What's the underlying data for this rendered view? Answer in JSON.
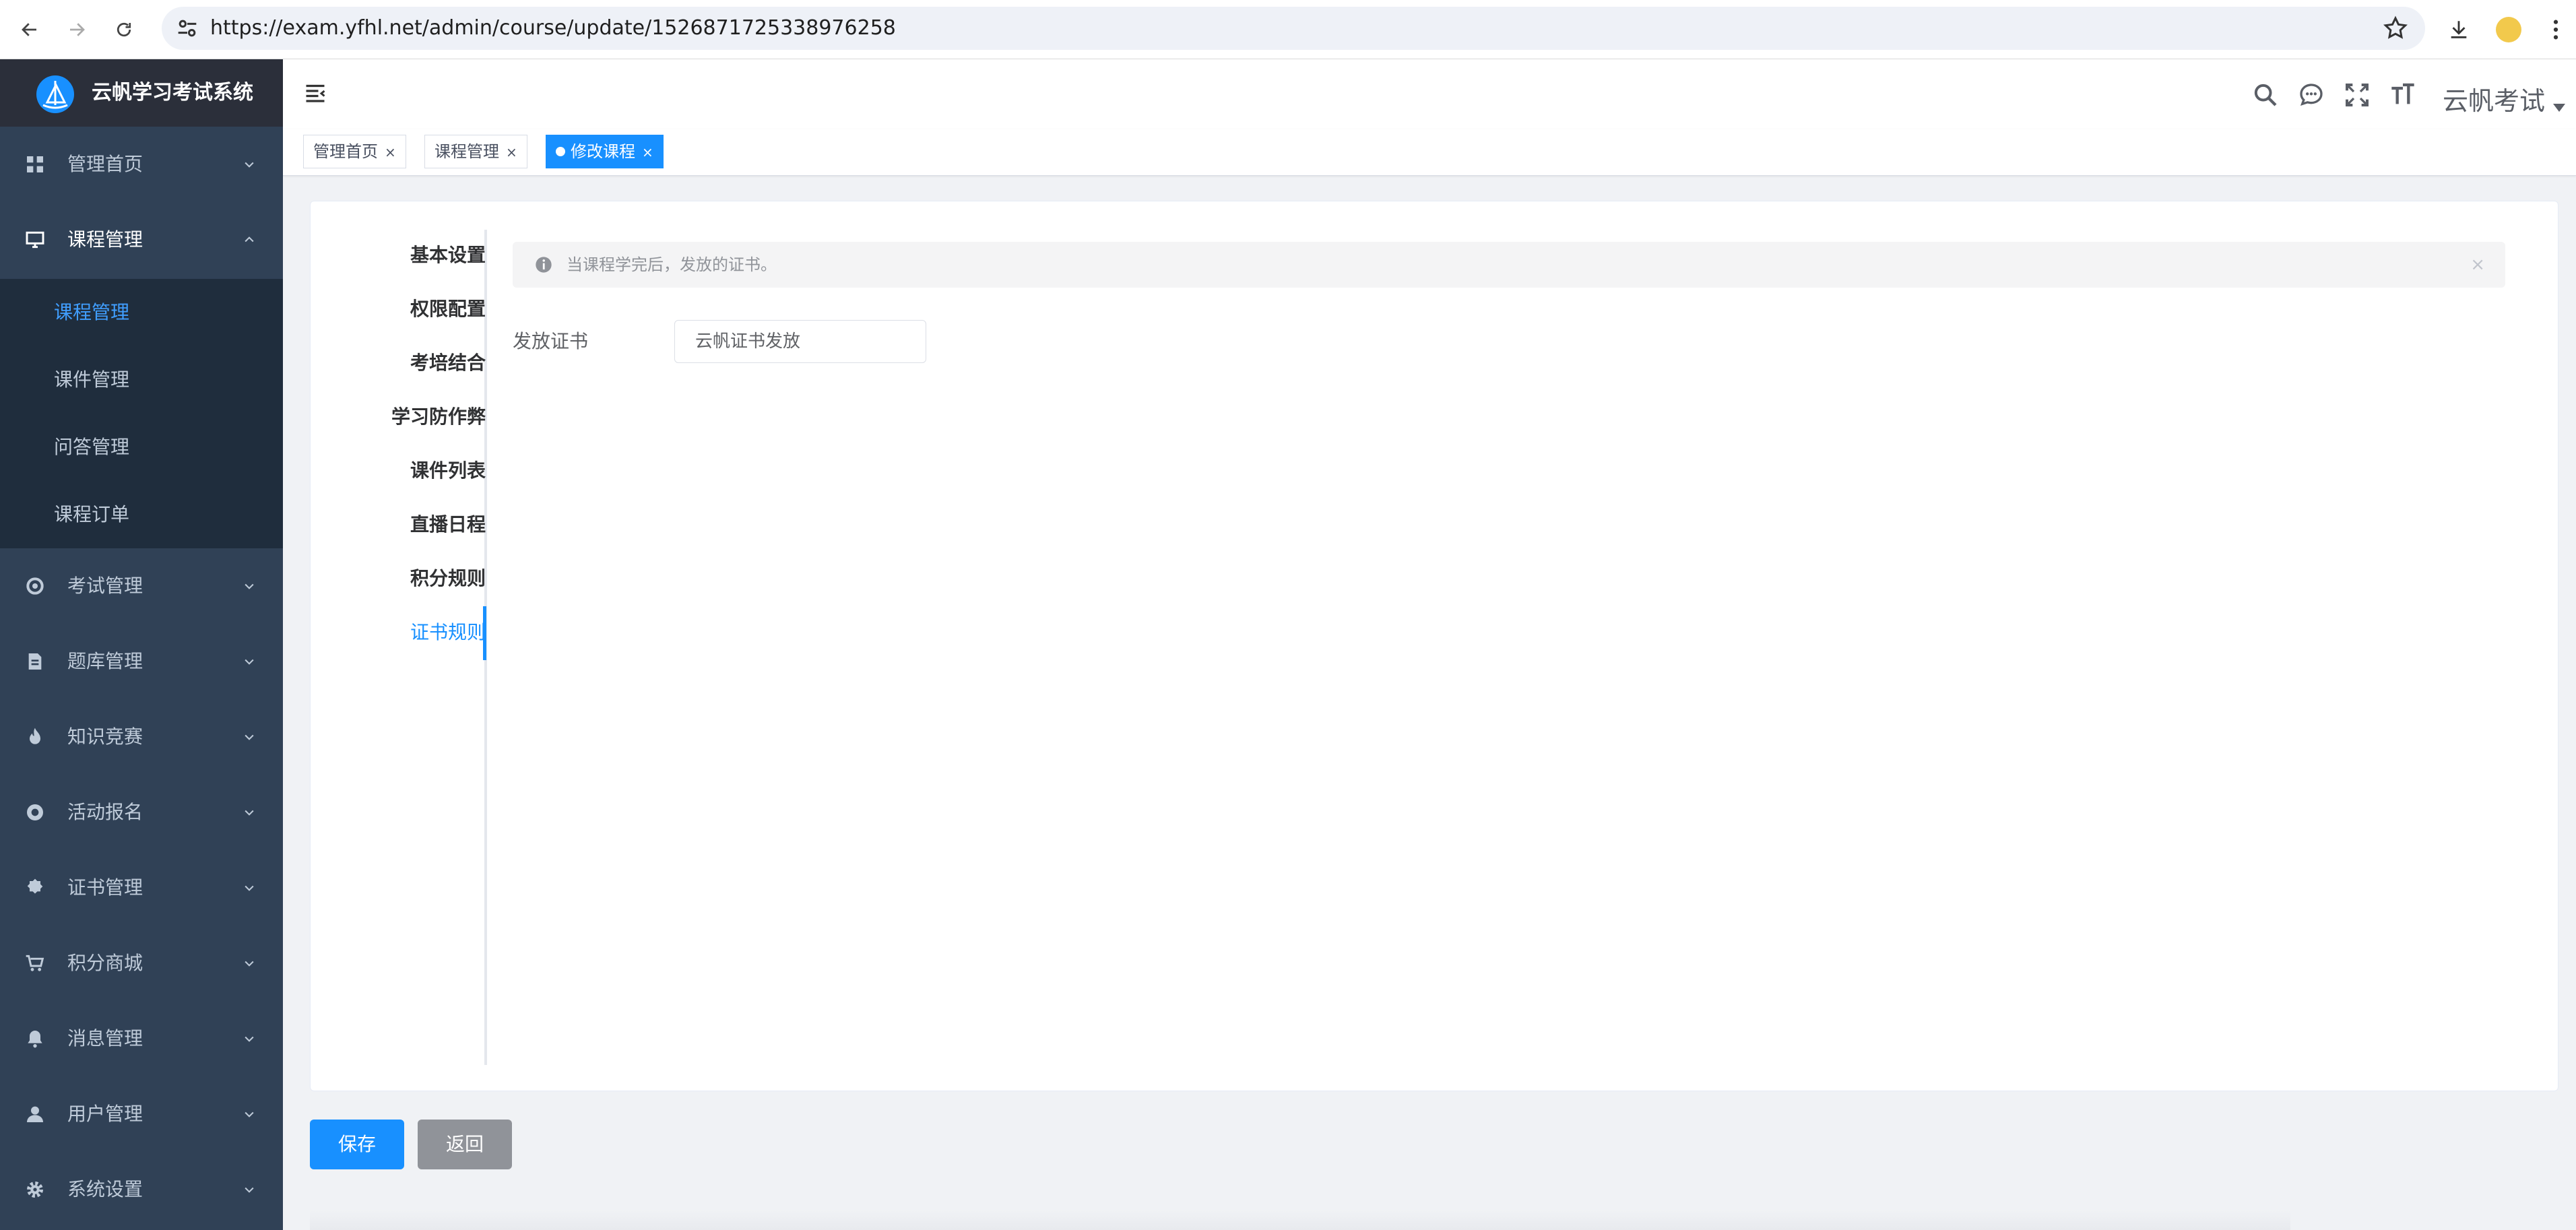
{
  "browser": {
    "url": "https://exam.yfhl.net/admin/course/update/1526871725338976258"
  },
  "app": {
    "title": "云帆学习考试系统"
  },
  "sidebar": {
    "items": [
      {
        "label": "管理首页",
        "icon": "dashboard-icon"
      },
      {
        "label": "课程管理",
        "icon": "monitor-icon",
        "expanded": true
      },
      {
        "label": "考试管理",
        "icon": "exam-icon"
      },
      {
        "label": "题库管理",
        "icon": "document-icon"
      },
      {
        "label": "知识竞赛",
        "icon": "fire-icon"
      },
      {
        "label": "活动报名",
        "icon": "target-icon"
      },
      {
        "label": "证书管理",
        "icon": "badge-icon"
      },
      {
        "label": "积分商城",
        "icon": "cart-icon"
      },
      {
        "label": "消息管理",
        "icon": "bell-icon"
      },
      {
        "label": "用户管理",
        "icon": "user-icon"
      },
      {
        "label": "系统设置",
        "icon": "gear-icon"
      }
    ],
    "subitems": [
      {
        "label": "课程管理",
        "active": true
      },
      {
        "label": "课件管理"
      },
      {
        "label": "问答管理"
      },
      {
        "label": "课程订单"
      }
    ]
  },
  "navbar": {
    "user": "云帆考试"
  },
  "tags": [
    {
      "label": "管理首页"
    },
    {
      "label": "课程管理"
    },
    {
      "label": "修改课程",
      "active": true
    }
  ],
  "tabs": [
    "基本设置",
    "权限配置",
    "考培结合",
    "学习防作弊",
    "课件列表",
    "直播日程",
    "积分规则",
    "证书规则"
  ],
  "active_tab": "证书规则",
  "alert": {
    "text": "当课程学完后，发放的证书。",
    "close": "×"
  },
  "form": {
    "label": "发放证书",
    "value": "云帆证书发放"
  },
  "buttons": {
    "save": "保存",
    "back": "返回"
  },
  "colors": {
    "accent": "#1890ff",
    "sidebar_bg": "#304156",
    "submenu_bg": "#1f2d3d",
    "active_text": "#409eff"
  }
}
